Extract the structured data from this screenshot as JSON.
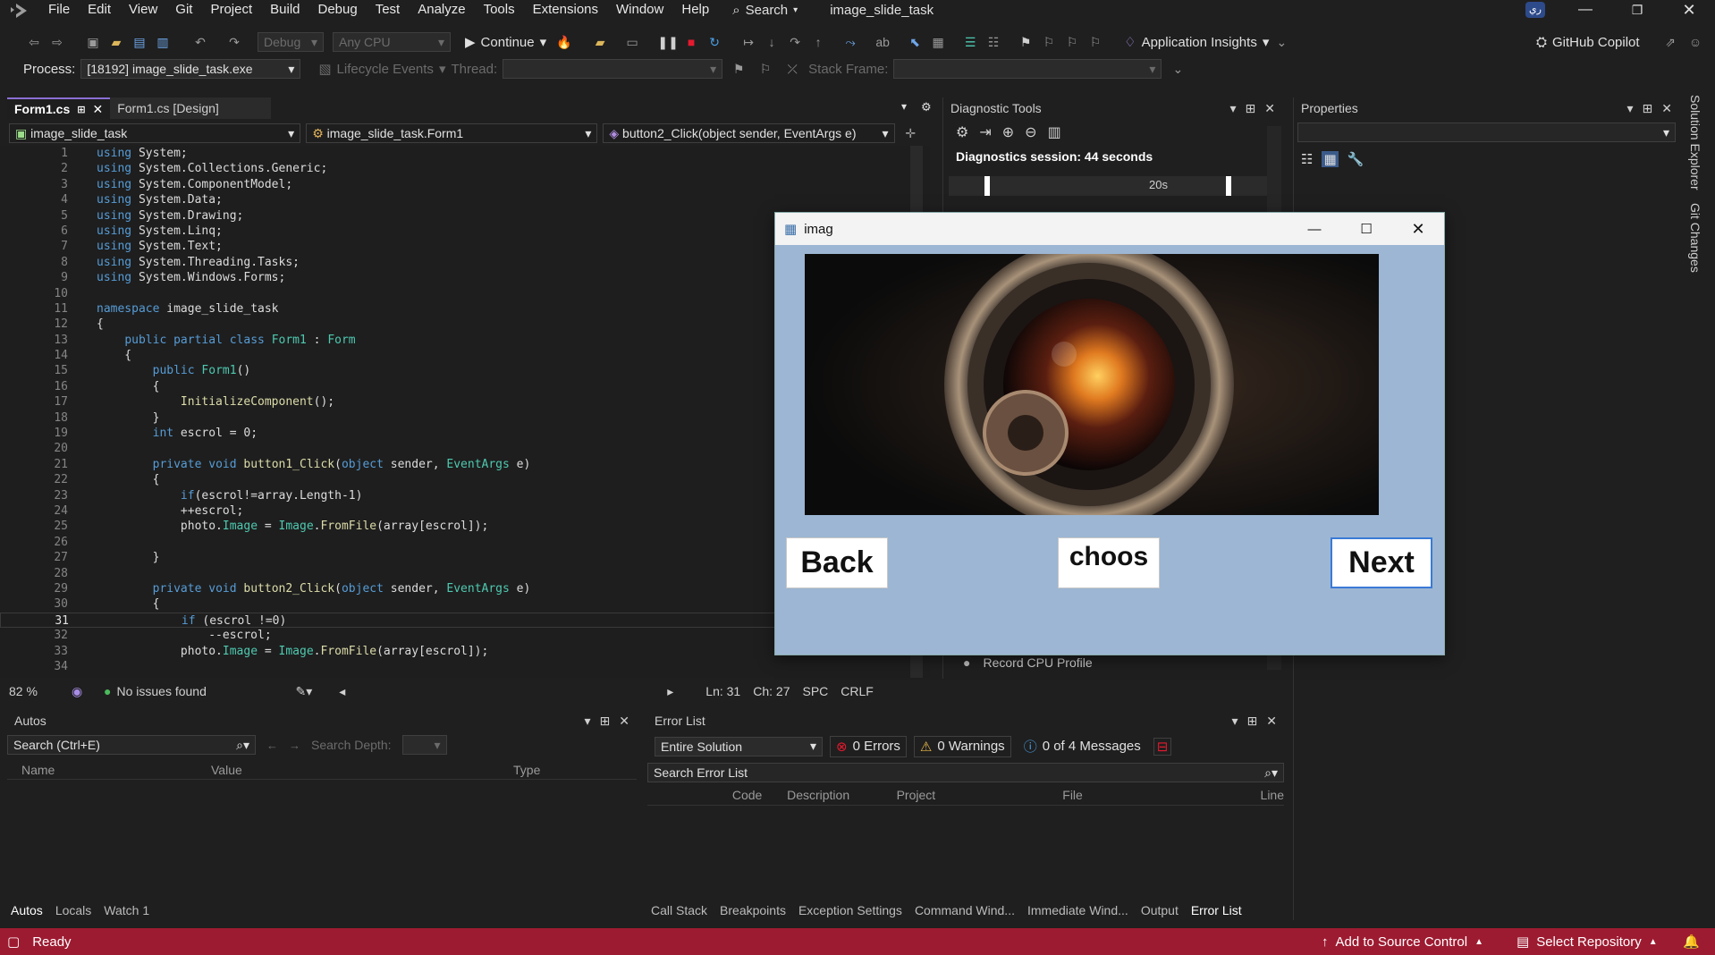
{
  "menu": [
    "File",
    "Edit",
    "View",
    "Git",
    "Project",
    "Build",
    "Debug",
    "Test",
    "Analyze",
    "Tools",
    "Extensions",
    "Window",
    "Help"
  ],
  "search_label": "Search",
  "solution_title": "image_slide_task",
  "user_initials": "ري",
  "toolbar": {
    "config": "Debug",
    "platform": "Any CPU",
    "continue": "Continue",
    "app_insights": "Application Insights",
    "copilot": "GitHub Copilot"
  },
  "process_bar": {
    "process_label": "Process:",
    "process_value": "[18192] image_slide_task.exe",
    "lifecycle": "Lifecycle Events",
    "thread_label": "Thread:",
    "stack_label": "Stack Frame:"
  },
  "tabs": [
    {
      "label": "Form1.cs",
      "active": true
    },
    {
      "label": "Form1.cs [Design]",
      "active": false
    }
  ],
  "nav": {
    "project": "image_slide_task",
    "class": "image_slide_task.Form1",
    "member": "button2_Click(object sender, EventArgs e)"
  },
  "code": [
    {
      "n": "1",
      "t": "using System;"
    },
    {
      "n": "2",
      "t": "using System.Collections.Generic;"
    },
    {
      "n": "3",
      "t": "using System.ComponentModel;"
    },
    {
      "n": "4",
      "t": "using System.Data;"
    },
    {
      "n": "5",
      "t": "using System.Drawing;"
    },
    {
      "n": "6",
      "t": "using System.Linq;"
    },
    {
      "n": "7",
      "t": "using System.Text;"
    },
    {
      "n": "8",
      "t": "using System.Threading.Tasks;"
    },
    {
      "n": "9",
      "t": "using System.Windows.Forms;"
    },
    {
      "n": "10",
      "t": ""
    },
    {
      "n": "11",
      "t": "namespace image_slide_task"
    },
    {
      "n": "12",
      "t": "{"
    },
    {
      "n": "13",
      "t": "    public partial class Form1 : Form"
    },
    {
      "n": "14",
      "t": "    {"
    },
    {
      "n": "15",
      "t": "        public Form1()"
    },
    {
      "n": "16",
      "t": "        {"
    },
    {
      "n": "17",
      "t": "            InitializeComponent();"
    },
    {
      "n": "18",
      "t": "        }"
    },
    {
      "n": "19",
      "t": "        int escrol = 0;"
    },
    {
      "n": "20",
      "t": ""
    },
    {
      "n": "21",
      "t": "        private void button1_Click(object sender, EventArgs e)"
    },
    {
      "n": "22",
      "t": "        {"
    },
    {
      "n": "23",
      "t": "            if(escrol!=array.Length-1)"
    },
    {
      "n": "24",
      "t": "            ++escrol;"
    },
    {
      "n": "25",
      "t": "            photo.Image = Image.FromFile(array[escrol]);"
    },
    {
      "n": "26",
      "t": ""
    },
    {
      "n": "27",
      "t": "        }"
    },
    {
      "n": "28",
      "t": ""
    },
    {
      "n": "29",
      "t": "        private void button2_Click(object sender, EventArgs e)"
    },
    {
      "n": "30",
      "t": "        {"
    },
    {
      "n": "31",
      "t": "            if (escrol !=0)"
    },
    {
      "n": "32",
      "t": "                --escrol;"
    },
    {
      "n": "33",
      "t": "            photo.Image = Image.FromFile(array[escrol]);"
    },
    {
      "n": "34",
      "t": ""
    }
  ],
  "editor_status": {
    "zoom": "82 %",
    "issues": "No issues found",
    "ln": "Ln: 31",
    "ch": "Ch: 27",
    "spc": "SPC",
    "crlf": "CRLF"
  },
  "diag": {
    "title": "Diagnostic Tools",
    "session": "Diagnostics session: 44 seconds",
    "tick": "20s",
    "record_cpu": "Record CPU Profile"
  },
  "properties": {
    "title": "Properties"
  },
  "side_tabs": [
    "Solution Explorer",
    "Git Changes"
  ],
  "autos": {
    "title": "Autos",
    "search_placeholder": "Search (Ctrl+E)",
    "depth_label": "Search Depth:",
    "columns": [
      "Name",
      "Value",
      "Type"
    ],
    "tabs": [
      "Autos",
      "Locals",
      "Watch 1"
    ]
  },
  "errors": {
    "title": "Error List",
    "scope": "Entire Solution",
    "errors": "0 Errors",
    "warnings": "0 Warnings",
    "messages": "0 of 4 Messages",
    "search_placeholder": "Search Error List",
    "columns": [
      "Code",
      "Description",
      "Project",
      "File",
      "Line"
    ],
    "tabs": [
      "Call Stack",
      "Breakpoints",
      "Exception Settings",
      "Command Wind...",
      "Immediate Wind...",
      "Output",
      "Error List"
    ]
  },
  "status": {
    "ready": "Ready",
    "source_control": "Add to Source Control",
    "repo": "Select Repository"
  },
  "winform": {
    "title": "imag",
    "back": "Back",
    "choose": "choos",
    "next": "Next"
  },
  "colors": {
    "status_bar": "#9d1b31",
    "form_bg": "#9cb6d3",
    "accent": "#8a6fd6"
  }
}
